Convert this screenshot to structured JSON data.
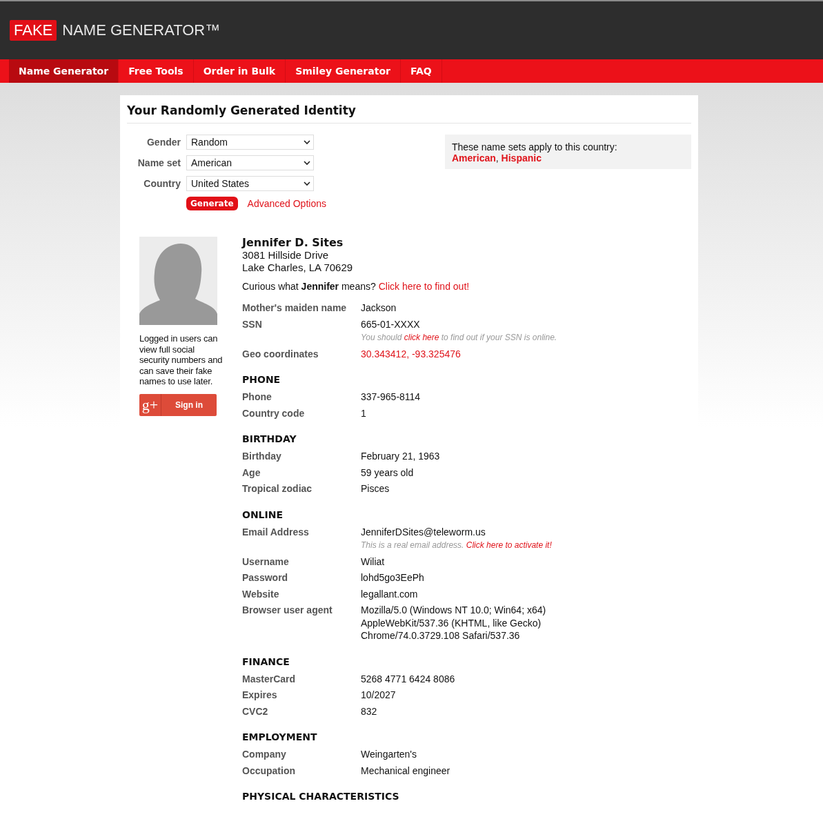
{
  "logo": {
    "badge": "FAKE",
    "text": "NAME GENERATOR™"
  },
  "nav": [
    {
      "label": "Name Generator",
      "selected": true
    },
    {
      "label": "Free Tools",
      "selected": false
    },
    {
      "label": "Order in Bulk",
      "selected": false
    },
    {
      "label": "Smiley Generator",
      "selected": false
    },
    {
      "label": "FAQ",
      "selected": false
    }
  ],
  "title": "Your Randomly Generated Identity",
  "form": {
    "fields": [
      {
        "label": "Gender",
        "value": "Random"
      },
      {
        "label": "Name set",
        "value": "American"
      },
      {
        "label": "Country",
        "value": "United States"
      }
    ],
    "generate": "Generate",
    "advanced": "Advanced Options"
  },
  "country_note": {
    "text": "These name sets apply to this country:",
    "sets": "**American**, **Hispanic**"
  },
  "sidebar": {
    "note": "Logged in users can view full social security numbers and can save their fake names to use later.",
    "sign_in": {
      "icon": "g+",
      "label": "Sign in"
    }
  },
  "identity": {
    "name": "Jennifer D. Sites",
    "address": [
      "3081 Hillside Drive",
      "Lake Charles, LA 70629"
    ],
    "curious": {
      "text": "Curious what **Jennifer** means?",
      "link": "Click here to find out!"
    }
  },
  "sections": [
    {
      "rows": [
        {
          "label": "Mother's maiden name",
          "kind": "text",
          "lines": [
            "Jackson"
          ]
        },
        {
          "label": "SSN",
          "kind": "text",
          "lines": [
            "665-01-XXXX"
          ],
          "note": {
            "before": "You should ",
            "link": "click here",
            "after": " to find out if your SSN is online."
          }
        },
        {
          "label": "Geo coordinates",
          "kind": "link",
          "lines": [
            "30.343412, -93.325476"
          ]
        }
      ]
    },
    {
      "heading": "PHONE",
      "rows": [
        {
          "label": "Phone",
          "kind": "text",
          "lines": [
            "337-965-8114"
          ]
        },
        {
          "label": "Country code",
          "kind": "text",
          "lines": [
            "1"
          ]
        }
      ]
    },
    {
      "heading": "BIRTHDAY",
      "rows": [
        {
          "label": "Birthday",
          "kind": "text",
          "lines": [
            "February 21, 1963"
          ]
        },
        {
          "label": "Age",
          "kind": "text",
          "lines": [
            "59 years old"
          ]
        },
        {
          "label": "Tropical zodiac",
          "kind": "text",
          "lines": [
            "Pisces"
          ]
        }
      ]
    },
    {
      "heading": "ONLINE",
      "rows": [
        {
          "label": "Email Address",
          "kind": "text",
          "lines": [
            "JenniferDSites@teleworm.us"
          ],
          "note": {
            "before": "This is a real email address. ",
            "link": "Click here to activate it!"
          }
        },
        {
          "label": "Username",
          "kind": "text",
          "lines": [
            "Wiliat"
          ]
        },
        {
          "label": "Password",
          "kind": "text",
          "lines": [
            "lohd5go3EePh"
          ]
        },
        {
          "label": "Website",
          "kind": "text",
          "lines": [
            "legallant.com"
          ]
        },
        {
          "label": "Browser user agent",
          "kind": "text",
          "lines": [
            "Mozilla/5.0 (Windows NT 10.0; Win64; x64)",
            "AppleWebKit/537.36 (KHTML, like Gecko)",
            "Chrome/74.0.3729.108 Safari/537.36"
          ]
        }
      ]
    },
    {
      "heading": "FINANCE",
      "rows": [
        {
          "label": "MasterCard",
          "kind": "text",
          "lines": [
            "5268 4771 6424 8086"
          ]
        },
        {
          "label": "Expires",
          "kind": "text",
          "lines": [
            "10/2027"
          ]
        },
        {
          "label": "CVC2",
          "kind": "text",
          "lines": [
            "832"
          ]
        }
      ]
    },
    {
      "heading": "EMPLOYMENT",
      "rows": [
        {
          "label": "Company",
          "kind": "text",
          "lines": [
            "Weingarten's"
          ]
        },
        {
          "label": "Occupation",
          "kind": "text",
          "lines": [
            "Mechanical engineer"
          ]
        }
      ]
    },
    {
      "heading": "PHYSICAL CHARACTERISTICS"
    }
  ]
}
